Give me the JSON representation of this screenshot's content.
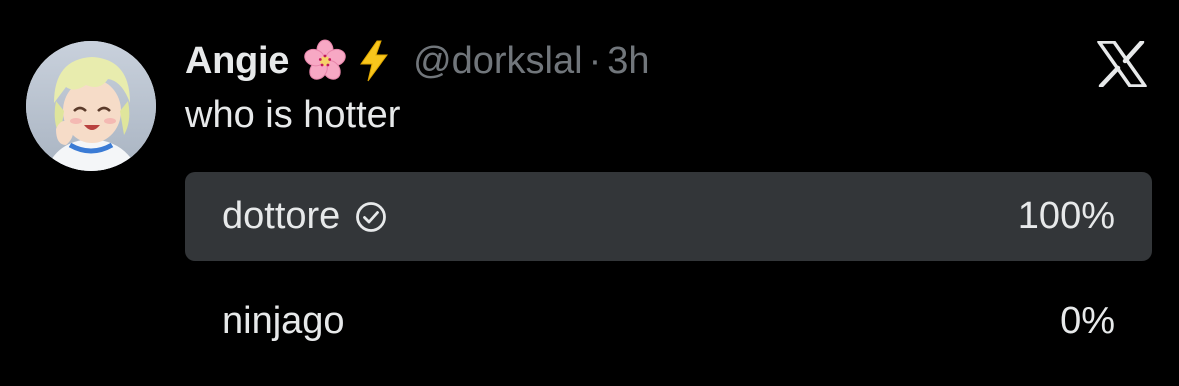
{
  "author": {
    "name": "Angie",
    "emojis": [
      "cherry-blossom",
      "high-voltage"
    ],
    "handle": "@dorkslal",
    "separator": "·",
    "time": "3h"
  },
  "tweet": {
    "text": "who is hotter"
  },
  "poll": {
    "options": [
      {
        "label": "dottore",
        "percent": "100%",
        "value": 100,
        "selected": true
      },
      {
        "label": "ninjago",
        "percent": "0%",
        "value": 0,
        "selected": false
      }
    ]
  },
  "colors": {
    "background": "#000000",
    "text_primary": "#e7e9ea",
    "text_secondary": "#71767b",
    "poll_bar": "#333639"
  },
  "icons": {
    "brand": "x-logo-icon",
    "selected_check": "check-circle-icon"
  }
}
